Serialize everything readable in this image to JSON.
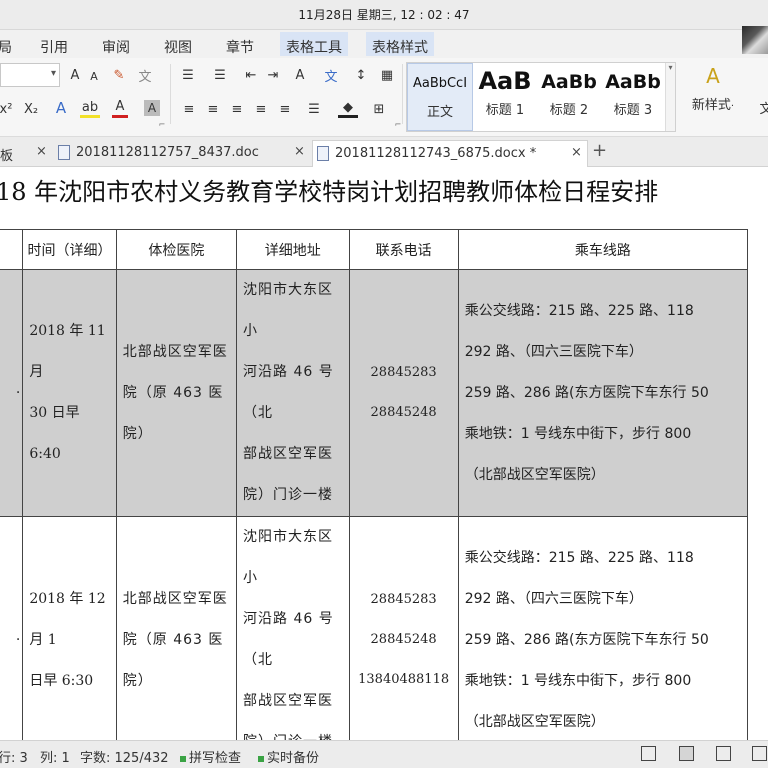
{
  "system": {
    "clock": "11月28日 星期三, 12 : 02 : 47"
  },
  "menu": {
    "items": [
      "局",
      "引用",
      "审阅",
      "视图",
      "章节"
    ],
    "tools": [
      "表格工具",
      "表格样式"
    ]
  },
  "ribbon": {
    "font_size": "",
    "styles": [
      {
        "sample": "AaBbCcI",
        "label": "正文"
      },
      {
        "sample": "AaB",
        "label": "标题 1"
      },
      {
        "sample": "AaBb",
        "label": "标题 2"
      },
      {
        "sample": "AaBb",
        "label": "标题 3"
      }
    ],
    "new_style_label": "新样式",
    "new_style_suffix": "·",
    "glyphs": {
      "grow_font": "A",
      "shrink_font": "A",
      "clear_format": "✎",
      "phonetic": "文",
      "superscript": "x²",
      "subscript": "X₂",
      "text_effect": "A",
      "highlight": "ab",
      "font_color": "A",
      "char_shading": "A",
      "bullet_list": "☰",
      "number_list": "☰",
      "outdent": "⇤",
      "indent": "⇥",
      "font_change": "A",
      "chinese_layout": "文",
      "sort": "↕",
      "borders_grid": "▦",
      "align_left": "≡",
      "align_center": "≡",
      "align_right": "≡",
      "justify": "≡",
      "distribute": "≡",
      "line_spacing": "☰",
      "shading": "◆",
      "borders": "⊞",
      "dropdown": "▾",
      "dialog_launcher": "⌐",
      "partial_right": "文"
    }
  },
  "tabs": [
    {
      "name": "板",
      "close": "×"
    },
    {
      "name": "20181128112757_8437.doc",
      "close": "×"
    },
    {
      "name": "20181128112743_6875.docx *",
      "close": "×"
    }
  ],
  "tab_add": "+",
  "document": {
    "title": "18 年沈阳市农村义务教育学校特岗计划招聘教师体检日程安排",
    "table": {
      "headers": [
        "）",
        "时间（详细）",
        "体检医院",
        "详细地址",
        "联系电话",
        "乘车线路"
      ],
      "rows": [
        {
          "col0": "·",
          "time_lines": [
            "2018 年 11 月",
            "30 日早 6:40"
          ],
          "hospital_lines": [
            "北部战区空军医",
            "院（原 463 医院）"
          ],
          "address_lines": [
            "沈阳市大东区小",
            "河沿路 46 号（北",
            "部战区空军医",
            "院）门诊一楼"
          ],
          "phones": [
            "28845283",
            "28845248"
          ],
          "route_lines": [
            "乘公交线路：215 路、225 路、118",
            "292 路、（四六三医院下车）",
            "259 路、286 路(东方医院下车东行 50",
            "乘地铁：1 号线东中街下，步行 800",
            "（北部战区空军医院）"
          ]
        },
        {
          "col0": "·",
          "time_lines": [
            "2018 年 12 月 1",
            "日早 6:30"
          ],
          "hospital_lines": [
            "北部战区空军医",
            "院（原 463 医院）"
          ],
          "address_lines": [
            "沈阳市大东区小",
            "河沿路 46 号（北",
            "部战区空军医",
            "院）门诊一楼"
          ],
          "phones": [
            "28845283",
            "28845248",
            "13840488118"
          ],
          "route_lines": [
            "乘公交线路：215 路、225 路、118",
            "292 路、（四六三医院下车）",
            "259 路、286 路(东方医院下车东行 50",
            "乘地铁：1 号线东中街下，步行 800",
            "（北部战区空军医院）"
          ]
        }
      ]
    }
  },
  "status": {
    "row": "行: 3",
    "col": "列: 1",
    "words": "字数: 125/432",
    "spell": "拼写检查",
    "backup": "实时备份"
  }
}
